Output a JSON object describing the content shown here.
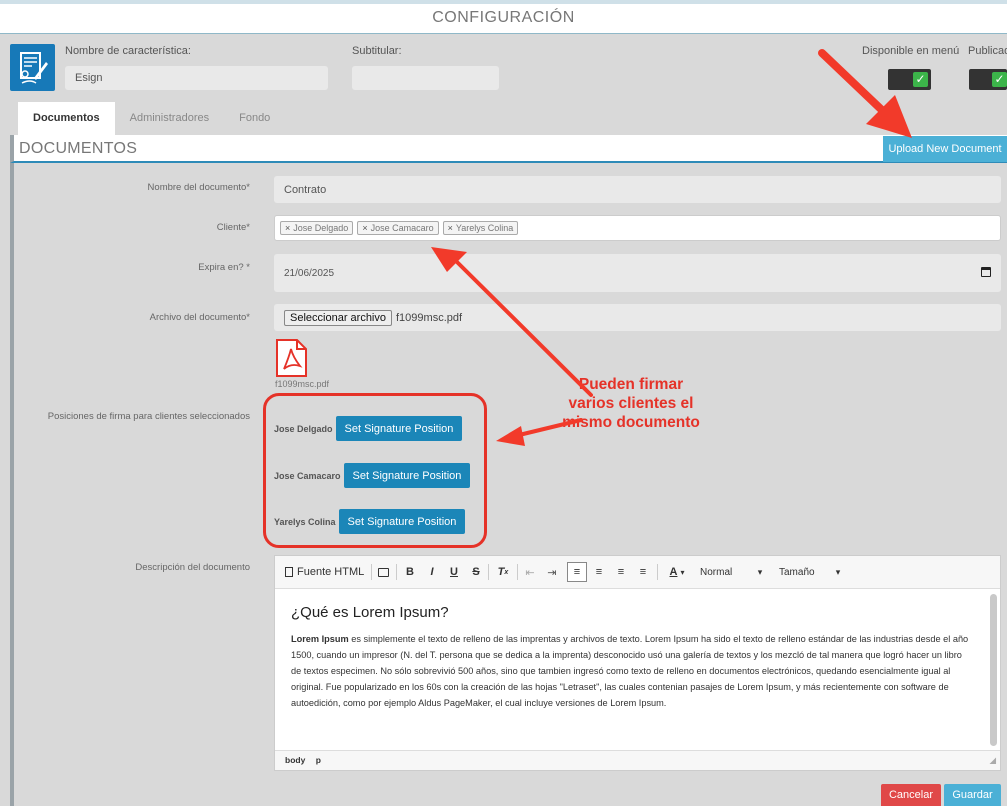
{
  "header": {
    "title": "CONFIGURACIÓN"
  },
  "feature": {
    "name_label": "Nombre de característica:",
    "name_value": "Esign",
    "subtitle_label": "Subtitular:",
    "subtitle_value": "",
    "menu_label": "Disponible en menú",
    "published_label": "Publicad",
    "menu_checked": true,
    "published_checked": true
  },
  "tabs": [
    {
      "label": "Documentos",
      "active": true
    },
    {
      "label": "Administradores",
      "active": false
    },
    {
      "label": "Fondo",
      "active": false
    }
  ],
  "panel": {
    "title": "DOCUMENTOS",
    "upload_label": "Upload New Document"
  },
  "form": {
    "doc_name_label": "Nombre del documento*",
    "doc_name_value": "Contrato",
    "client_label": "Cliente*",
    "clients": [
      "Jose Delgado",
      "Jose Camacaro",
      "Yarelys Colina"
    ],
    "expires_label": "Expira en? *",
    "expires_value": "21/06/2025",
    "file_label": "Archivo del documento*",
    "file_button": "Seleccionar archivo",
    "file_name": "f1099msc.pdf",
    "file_thumb_name": "f1099msc.pdf",
    "positions_label": "Posiciones de firma para clientes seleccionados",
    "signature_button": "Set Signature Position",
    "signers": [
      "Jose Delgado",
      "Jose Camacaro",
      "Yarelys Colina"
    ],
    "description_label": "Descripción del documento"
  },
  "editor": {
    "source_label": "Fuente HTML",
    "format_label": "Normal",
    "size_label": "Tamaño",
    "heading": "¿Qué es Lorem Ipsum?",
    "body_bold": "Lorem Ipsum",
    "body_text": " es simplemente el texto de relleno de las imprentas y archivos de texto. Lorem Ipsum ha sido el texto de relleno estándar de las industrias desde el año 1500, cuando un impresor (N. del T. persona que se dedica a la imprenta) desconocido usó una galería de textos y los mezcló de tal manera que logró hacer un libro de textos especimen. No sólo sobrevivió 500 años, sino que tambien ingresó como texto de relleno en documentos electrónicos, quedando esencialmente igual al original. Fue popularizado en los 60s con la creación de las hojas \"Letraset\", las cuales contenian pasajes de Lorem Ipsum, y más recientemente con software de autoedición, como por ejemplo Aldus PageMaker, el cual incluye versiones de Lorem Ipsum.",
    "path_body": "body",
    "path_p": "p"
  },
  "actions": {
    "cancel": "Cancelar",
    "save": "Guardar"
  },
  "annotation": {
    "text": "Pueden firmar varios clientes el mismo documento"
  },
  "colors": {
    "accent": "#1b86b8",
    "upload": "#4bb0d6",
    "danger": "#e04848",
    "annotation": "#e53228"
  }
}
